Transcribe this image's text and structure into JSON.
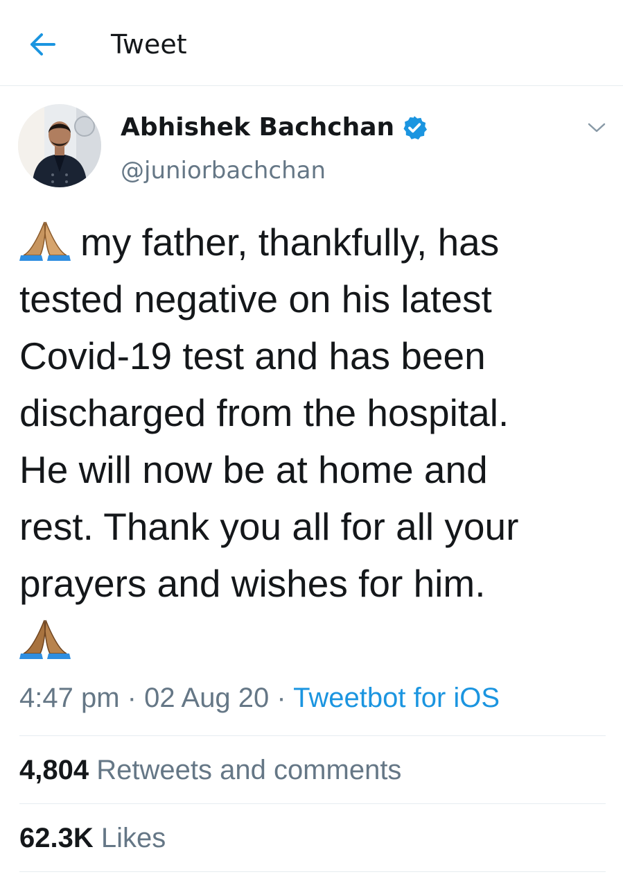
{
  "header": {
    "title": "Tweet",
    "back_icon": "arrow-left-icon",
    "accent_color": "#1b95e0"
  },
  "tweet": {
    "author": {
      "name": "Abhishek Bachchan",
      "handle": "@juniorbachchan",
      "verified": true,
      "verified_icon": "verified-badge-icon"
    },
    "caret_icon": "chevron-down-icon",
    "emoji_icon": "folded-hands-emoji",
    "text_lines": [
      "my father, thankfully, has",
      "tested negative on his latest",
      "Covid-19 test and has been",
      "discharged from the hospital.",
      "He will now be at home and",
      "rest. Thank you all for all your",
      "prayers and wishes for him."
    ],
    "time": "4:47 pm",
    "separator": "·",
    "date": "02 Aug 20",
    "source": "Tweetbot for iOS",
    "retweets": {
      "count": "4,804",
      "label": "Retweets and comments"
    },
    "likes": {
      "count": "62.3K",
      "label": "Likes"
    }
  }
}
